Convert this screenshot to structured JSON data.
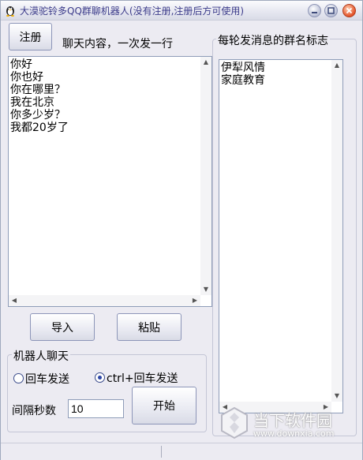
{
  "window": {
    "title": "大漠驼铃多QQ群聊机器人(没有注册,注册后方可使用)"
  },
  "toolbar": {
    "register_label": "注册",
    "content_hint": "聊天内容，一次发一行"
  },
  "message_box": {
    "lines": [
      "你好",
      "你也好",
      "你在哪里？",
      "我在北京",
      "你多少岁？",
      "我都20岁了"
    ]
  },
  "group_panel": {
    "title": "每轮发消息的群名标志",
    "lines": [
      "伊犁风情",
      "家庭教育"
    ]
  },
  "actions": {
    "import_label": "导入",
    "paste_label": "粘贴"
  },
  "robot_group": {
    "title": "机器人聊天",
    "radio_enter": "回车发送",
    "radio_ctrl_enter": "ctrl+回车发送",
    "selected": "ctrl_enter",
    "interval_label": "间隔秒数",
    "interval_value": "10",
    "start_label": "开始"
  },
  "watermark": {
    "text": "当下软件园",
    "url": "www.downxia.com"
  },
  "icons": {
    "app": "penguin-icon",
    "minimize": "minimize-icon",
    "maximize": "maximize-icon",
    "close": "close-icon"
  },
  "colors": {
    "title_text": "#3b3b8a",
    "close_button": "#e4532a",
    "window_bg": "#ecebf2"
  }
}
